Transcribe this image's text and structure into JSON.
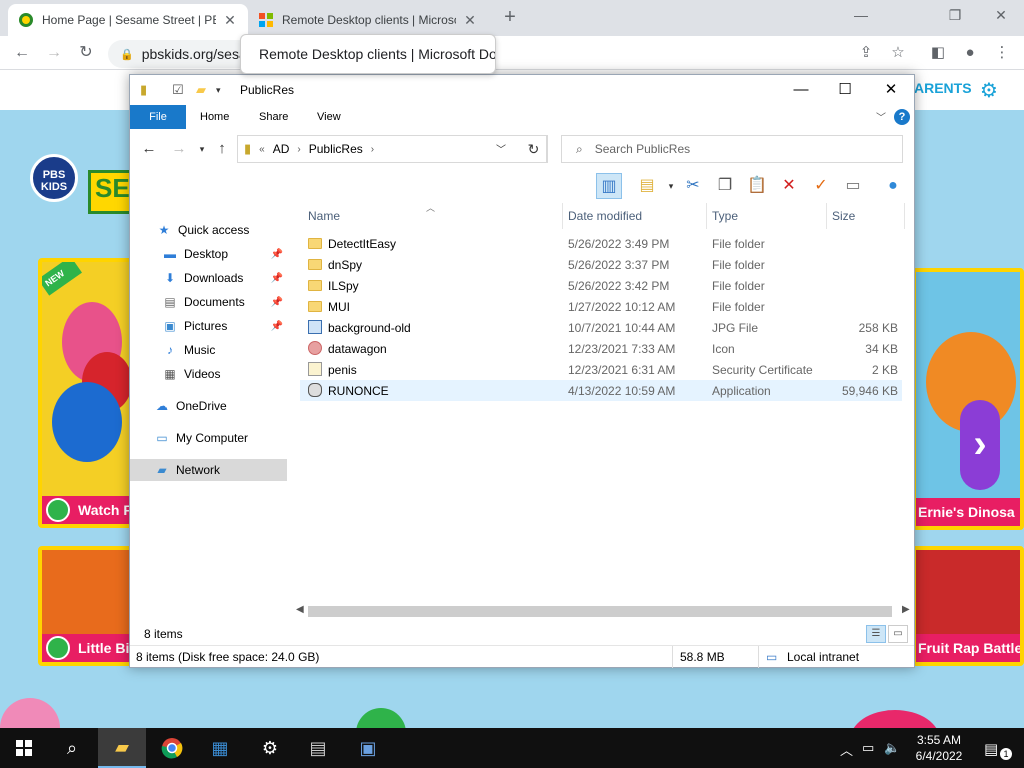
{
  "browser": {
    "tabs": [
      {
        "title": "Home Page | Sesame Street | PBS KIDS",
        "active": true
      },
      {
        "title": "Remote Desktop clients | Microsoft Docs",
        "active": false
      }
    ],
    "url": "pbskids.org/sesa",
    "tooltip": "Remote Desktop clients | Microsoft Docs"
  },
  "pbs": {
    "parents_label": "ARENTS",
    "logo_text": "PBS KIDS",
    "sesame_text": "SES",
    "new_badge": "NEW",
    "cards": [
      {
        "label": "Watch F"
      },
      {
        "label": "Little Bi"
      },
      {
        "label": "Ernie's Dinosa"
      },
      {
        "label": "Fruit Rap Battle"
      }
    ]
  },
  "explorer": {
    "title": "PublicRes",
    "ribbon_tabs": [
      "File",
      "Home",
      "Share",
      "View"
    ],
    "address": [
      "AD",
      "PublicRes"
    ],
    "search_placeholder": "Search PublicRes",
    "nav": {
      "quick_access": "Quick access",
      "items": [
        {
          "label": "Desktop",
          "pinned": true
        },
        {
          "label": "Downloads",
          "pinned": true
        },
        {
          "label": "Documents",
          "pinned": true
        },
        {
          "label": "Pictures",
          "pinned": true
        },
        {
          "label": "Music",
          "pinned": false
        },
        {
          "label": "Videos",
          "pinned": false
        }
      ],
      "onedrive": "OneDrive",
      "my_computer": "My Computer",
      "network": "Network"
    },
    "columns": {
      "name": "Name",
      "date": "Date modified",
      "type": "Type",
      "size": "Size"
    },
    "files": [
      {
        "name": "DetectItEasy",
        "date": "5/26/2022 3:49 PM",
        "type": "File folder",
        "size": "",
        "icon": "folder"
      },
      {
        "name": "dnSpy",
        "date": "5/26/2022 3:37 PM",
        "type": "File folder",
        "size": "",
        "icon": "folder"
      },
      {
        "name": "ILSpy",
        "date": "5/26/2022 3:42 PM",
        "type": "File folder",
        "size": "",
        "icon": "folder"
      },
      {
        "name": "MUI",
        "date": "1/27/2022 10:12 AM",
        "type": "File folder",
        "size": "",
        "icon": "folder"
      },
      {
        "name": "background-old",
        "date": "10/7/2021 10:44 AM",
        "type": "JPG File",
        "size": "258 KB",
        "icon": "image"
      },
      {
        "name": "datawagon",
        "date": "12/23/2021 7:33 AM",
        "type": "Icon",
        "size": "34 KB",
        "icon": "ico"
      },
      {
        "name": "penis",
        "date": "12/23/2021 6:31 AM",
        "type": "Security Certificate",
        "size": "2 KB",
        "icon": "cert"
      },
      {
        "name": "RUNONCE",
        "date": "4/13/2022 10:59 AM",
        "type": "Application",
        "size": "59,946 KB",
        "icon": "app"
      }
    ],
    "status_count": "8 items",
    "status_bar": {
      "details": "8 items (Disk free space: 24.0 GB)",
      "size": "58.8 MB",
      "zone": "Local intranet"
    }
  },
  "taskbar": {
    "time": "3:55 AM",
    "date": "6/4/2022",
    "notification_count": "1"
  }
}
